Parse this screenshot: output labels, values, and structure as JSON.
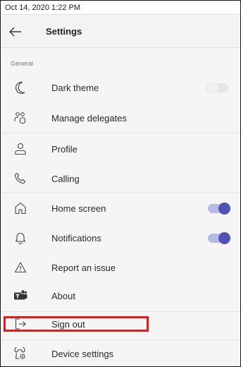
{
  "status_bar": {
    "datetime": "Oct 14, 2020 1:22 PM"
  },
  "header": {
    "title": "Settings",
    "back_icon": "arrow-left-icon"
  },
  "section": {
    "label": "General"
  },
  "items": [
    {
      "label": "Dark theme",
      "icon": "moon-icon",
      "toggle": "off"
    },
    {
      "label": "Manage delegates",
      "icon": "people-icon"
    },
    {
      "label": "Profile",
      "icon": "person-icon"
    },
    {
      "label": "Calling",
      "icon": "phone-icon"
    },
    {
      "label": "Home screen",
      "icon": "home-icon",
      "toggle": "on"
    },
    {
      "label": "Notifications",
      "icon": "bell-icon",
      "toggle": "on"
    },
    {
      "label": "Report an issue",
      "icon": "warning-icon"
    },
    {
      "label": "About",
      "icon": "teams-logo-icon"
    },
    {
      "label": "Sign out",
      "icon": "sign-out-icon",
      "highlighted": true
    },
    {
      "label": "Device settings",
      "icon": "device-settings-icon"
    }
  ],
  "colors": {
    "accent": "#4f52b2",
    "highlight": "#e41b1b",
    "toggle_off": "#e6e6e6"
  }
}
